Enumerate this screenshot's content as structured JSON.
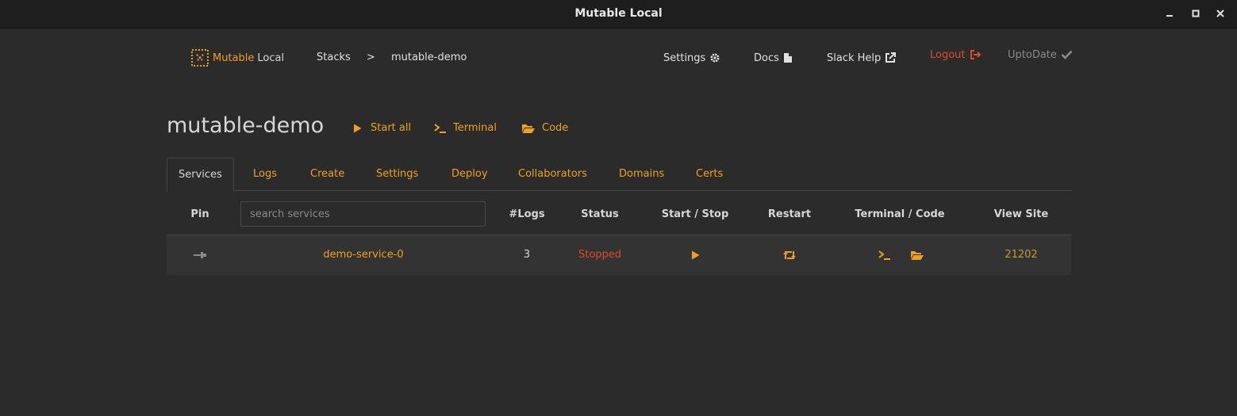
{
  "window": {
    "title": "Mutable Local"
  },
  "brand": {
    "name_accent": "Mutable",
    "name_rest": "Local"
  },
  "breadcrumb": {
    "root": "Stacks",
    "separator": ">",
    "current": "mutable-demo"
  },
  "nav": {
    "settings": "Settings",
    "docs": "Docs",
    "slack_help": "Slack Help",
    "logout": "Logout",
    "uptodate": "UptoDate"
  },
  "stack": {
    "name": "mutable-demo",
    "actions": {
      "start_all": "Start all",
      "terminal": "Terminal",
      "code": "Code"
    }
  },
  "tabs": [
    "Services",
    "Logs",
    "Create",
    "Settings",
    "Deploy",
    "Collaborators",
    "Domains",
    "Certs"
  ],
  "table": {
    "headers": {
      "pin": "Pin",
      "logs": "#Logs",
      "status": "Status",
      "start_stop": "Start / Stop",
      "restart": "Restart",
      "terminal_code": "Terminal / Code",
      "view_site": "View Site"
    },
    "search_placeholder": "search services",
    "rows": [
      {
        "name": "demo-service-0",
        "logs": "3",
        "status": "Stopped",
        "port": "21202"
      }
    ]
  },
  "colors": {
    "accent": "#f0a020",
    "danger": "#e04a2a",
    "muted": "#8a8a8a",
    "background": "#2b2b2b"
  },
  "icons": [
    "minimize-icon",
    "maximize-icon",
    "close-icon",
    "logo-icon",
    "gear-icon",
    "document-icon",
    "external-link-icon",
    "logout-icon",
    "check-icon",
    "play-icon",
    "terminal-icon",
    "folder-open-icon",
    "pin-icon",
    "retweet-icon"
  ]
}
